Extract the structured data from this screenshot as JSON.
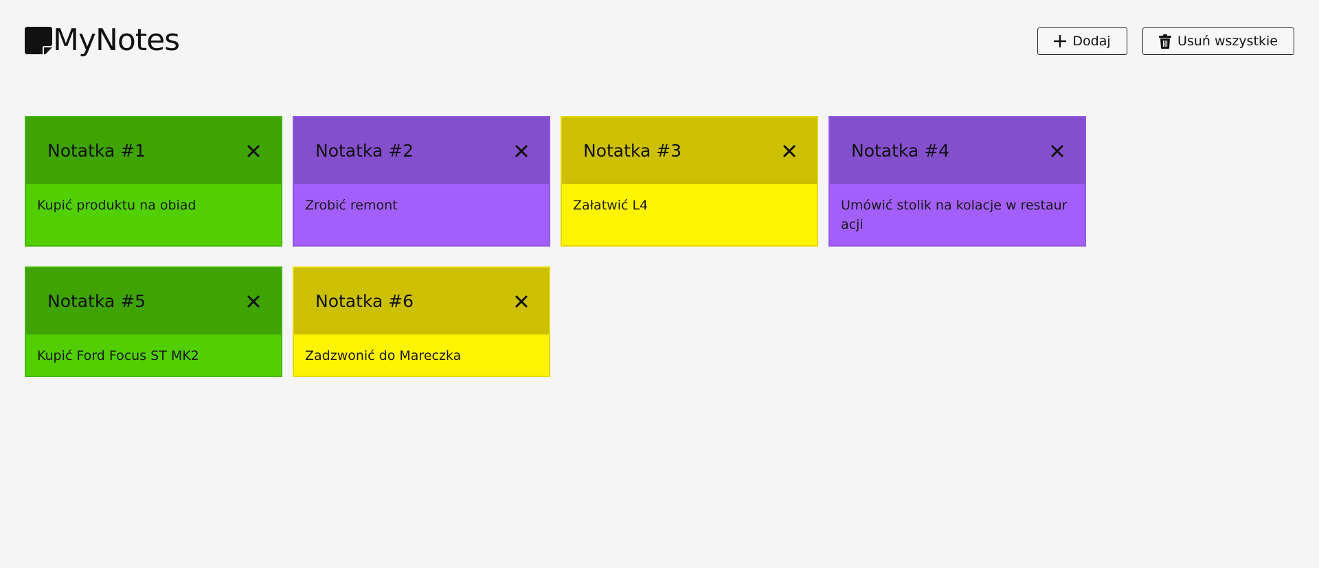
{
  "app": {
    "name": "MyNotes",
    "logo_icon": "sticky-note-icon"
  },
  "toolbar": {
    "add_label": "Dodaj",
    "add_icon": "plus-icon",
    "clear_label": "Usuń wszystkie",
    "clear_icon": "trash-icon"
  },
  "colors": {
    "background": "#f5f5f5",
    "green": {
      "header": "#3fa301",
      "body": "#51cf00",
      "border": "#45b800"
    },
    "purple": {
      "header": "#844fcc",
      "body": "#a35ffb",
      "border": "#9355e2"
    },
    "yellow": {
      "header": "#cdc000",
      "body": "#fff400",
      "border": "#e6d900"
    }
  },
  "notes": [
    {
      "title": "Notatka #1",
      "text": "Kupić produktu na obiad",
      "color": "green",
      "close_icon": "close-icon"
    },
    {
      "title": "Notatka #2",
      "text": "Zrobić remont",
      "color": "purple",
      "close_icon": "close-icon"
    },
    {
      "title": "Notatka #3",
      "text": "Załatwić L4",
      "color": "yellow",
      "close_icon": "close-icon"
    },
    {
      "title": "Notatka #4",
      "text": "Umówić stolik na kolacje w restauracji",
      "color": "purple",
      "close_icon": "close-icon"
    },
    {
      "title": "Notatka #5",
      "text": "Kupić Ford Focus ST MK2",
      "color": "green",
      "close_icon": "close-icon"
    },
    {
      "title": "Notatka #6",
      "text": "Zadzwonić do Mareczka",
      "color": "yellow",
      "close_icon": "close-icon"
    }
  ]
}
